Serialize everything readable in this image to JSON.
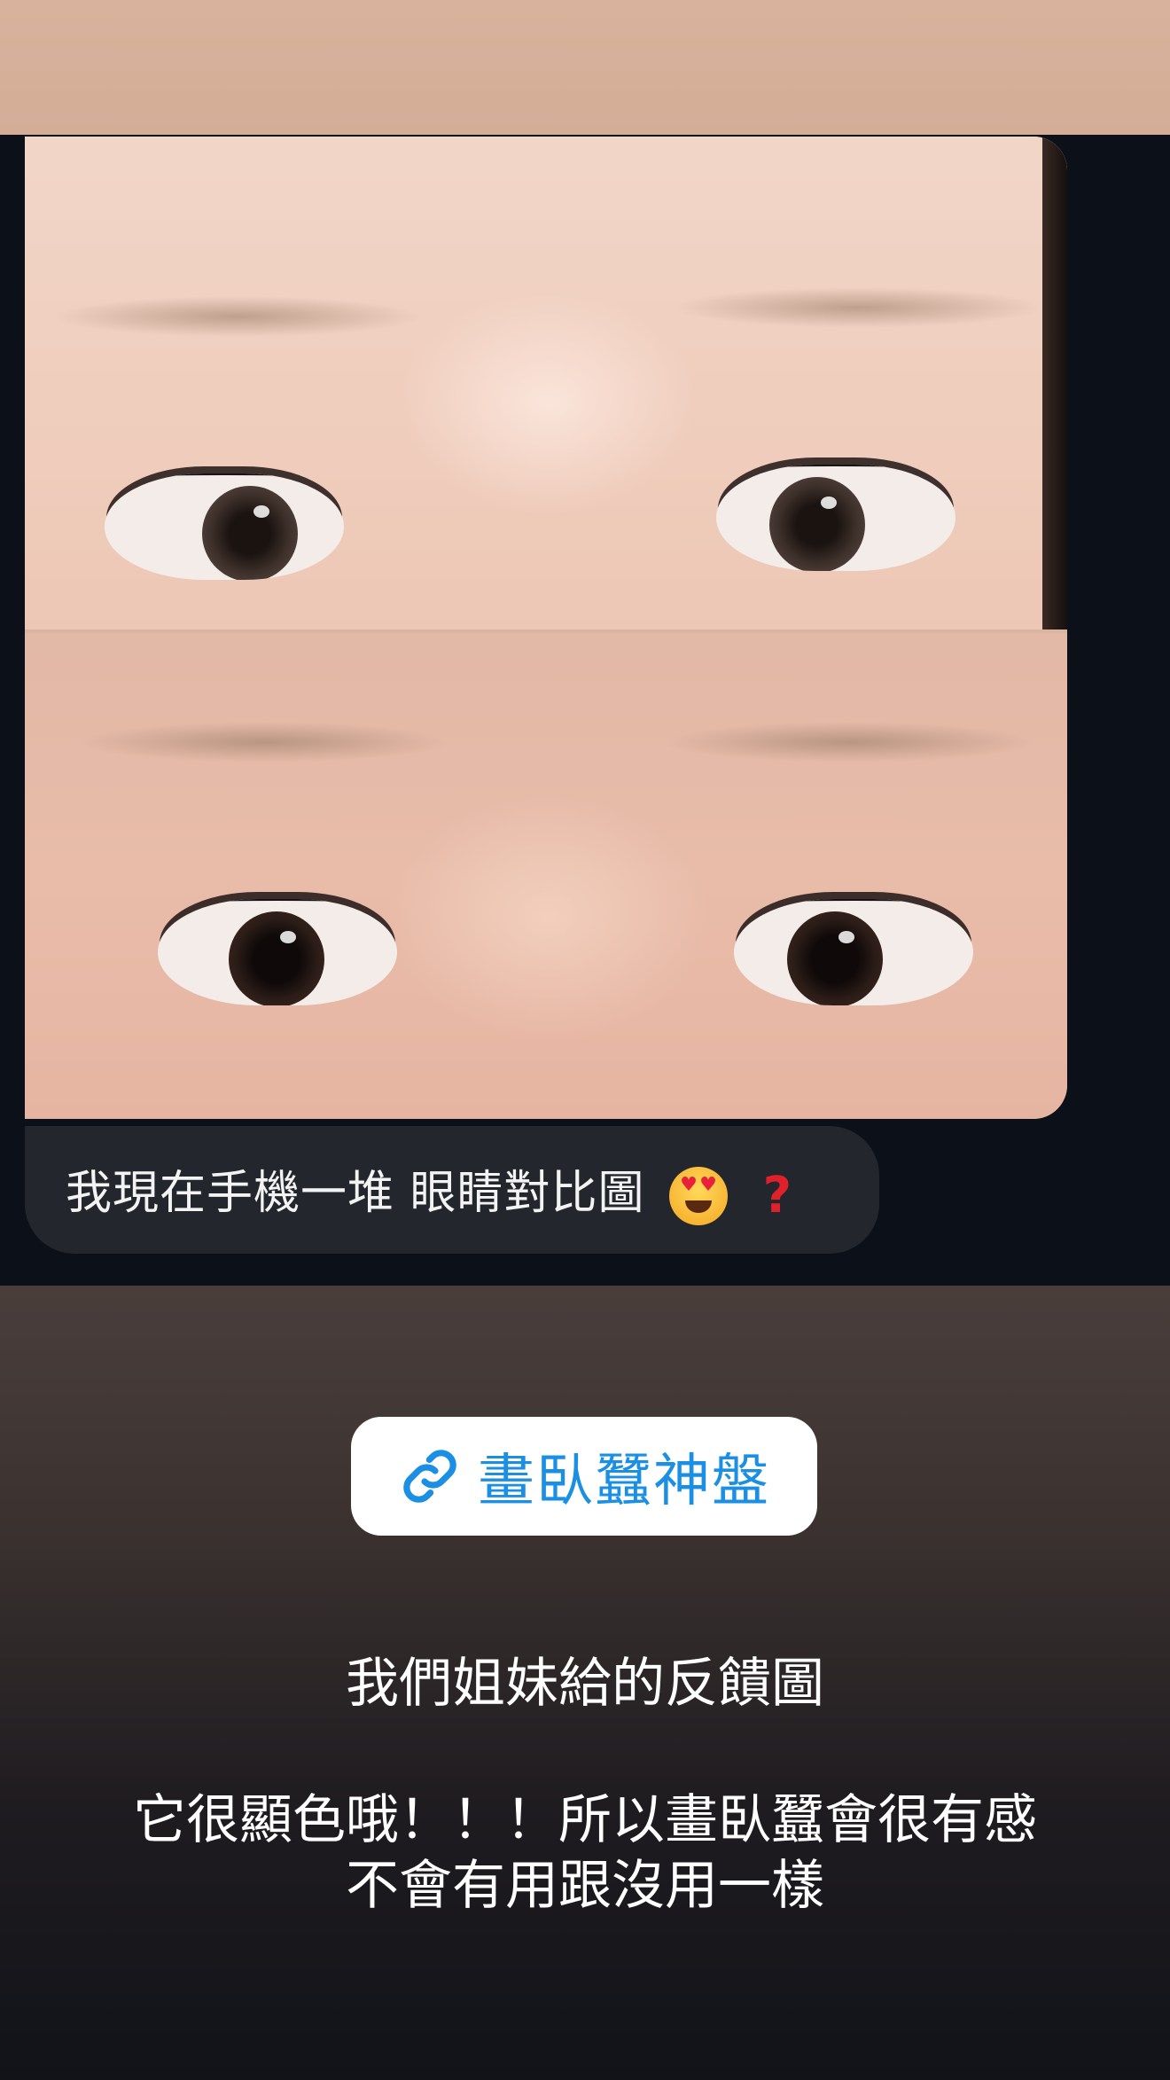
{
  "message": {
    "text": "我現在手機一堆 眼睛對比圖",
    "emojis": [
      "heart-eyes-emoji",
      "red-question-mark-emoji"
    ]
  },
  "link_sticker": {
    "label": "畫臥蠶神盤",
    "icon": "link-icon",
    "color": "#1a8fe3"
  },
  "caption": {
    "line1": "我們姐妹給的反饋圖",
    "line2": "它很顯色哦！！！所以畫臥蠶會很有感",
    "line3": "不會有用跟沒用一樣"
  }
}
